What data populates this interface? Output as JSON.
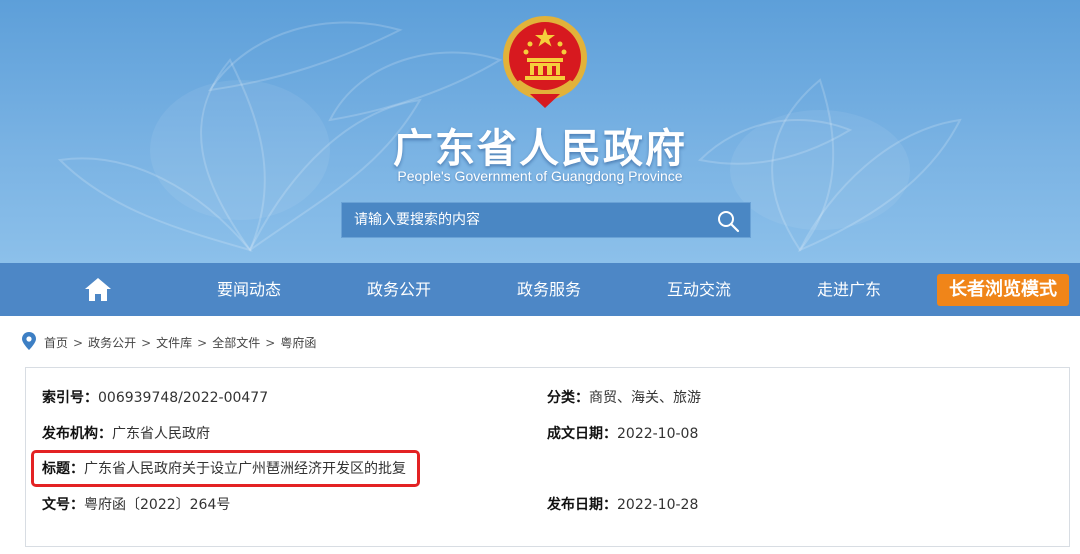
{
  "header": {
    "title_cn": "广东省人民政府",
    "title_en": "People's Government of Guangdong Province",
    "emblem_icon": "national-emblem-icon",
    "search": {
      "placeholder": "请输入要搜索的内容",
      "icon": "search-icon"
    }
  },
  "nav": {
    "home_icon": "home-icon",
    "items": [
      {
        "label": "要闻动态"
      },
      {
        "label": "政务公开"
      },
      {
        "label": "政务服务"
      },
      {
        "label": "互动交流"
      },
      {
        "label": "走进广东"
      }
    ],
    "elder_mode": "长者浏览模式"
  },
  "breadcrumb": {
    "icon": "location-pin-icon",
    "items": [
      "首页",
      "政务公开",
      "文件库",
      "全部文件",
      "粤府函"
    ],
    "separator": ">"
  },
  "document": {
    "index_no": {
      "key": "索引号：",
      "value": "006939748/2022-00477"
    },
    "category": {
      "key": "分类：",
      "value": "商贸、海关、旅游"
    },
    "issuer": {
      "key": "发布机构：",
      "value": "广东省人民政府"
    },
    "created": {
      "key": "成文日期：",
      "value": "2022-10-08"
    },
    "title": {
      "key": "标题：",
      "value": "广东省人民政府关于设立广州琶洲经济开发区的批复"
    },
    "doc_no": {
      "key": "文号：",
      "value": "粤府函〔2022〕264号"
    },
    "published": {
      "key": "发布日期：",
      "value": "2022-10-28"
    }
  },
  "colors": {
    "banner": "#6fa9df",
    "nav": "#4d87c6",
    "elder_button": "#f08519",
    "highlight": "#e32223"
  }
}
